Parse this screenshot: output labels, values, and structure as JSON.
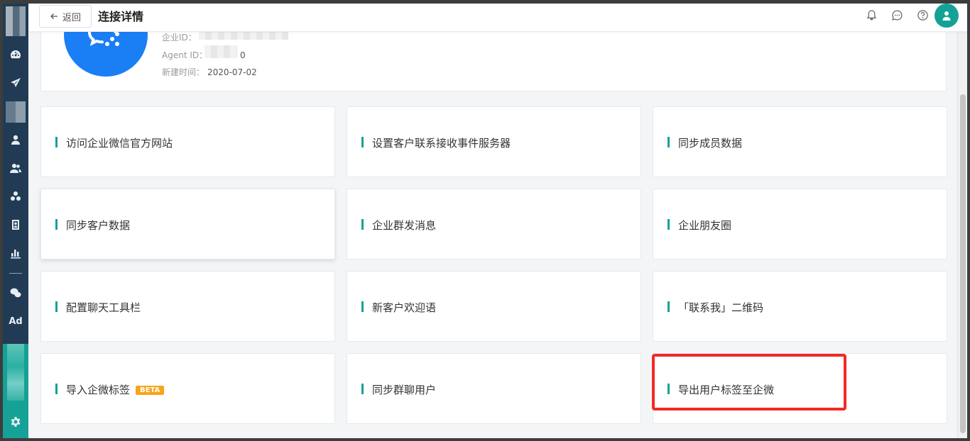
{
  "header": {
    "back_label": "返回",
    "title": "连接详情",
    "icons": [
      "bell-icon",
      "chat-icon",
      "help-icon",
      "user-avatar-icon"
    ]
  },
  "info": {
    "corp_id_label": "企业ID：",
    "agent_id_label": "Agent ID：",
    "agent_id_value_fragment": "0",
    "created_label": "新建时间：",
    "created_value": "2020-07-02"
  },
  "tiles": [
    {
      "label": "访问企业微信官方网站"
    },
    {
      "label": "设置客户联系接收事件服务器"
    },
    {
      "label": "同步成员数据"
    },
    {
      "label": "同步客户数据"
    },
    {
      "label": "企业群发消息"
    },
    {
      "label": "企业朋友圈"
    },
    {
      "label": "配置聊天工具栏"
    },
    {
      "label": "新客户欢迎语"
    },
    {
      "label": "「联系我」二维码"
    },
    {
      "label": "导入企微标签",
      "badge": "BETA"
    },
    {
      "label": "同步群聊用户"
    },
    {
      "label": "导出用户标签至企微"
    }
  ],
  "sidebar": {
    "ad_label": "Ad",
    "icons": [
      "dashboard-icon",
      "send-icon",
      "user-icon",
      "users-icon",
      "group-icon",
      "contact-card-icon",
      "bar-chart-icon",
      "wechat-icon",
      "ad-icon",
      "settings-icon"
    ]
  },
  "colors": {
    "accent": "#15a196",
    "sidebar": "#213b54",
    "logo": "#1a7ff5",
    "highlight": "#f02a26",
    "beta": "#f8a51b"
  }
}
